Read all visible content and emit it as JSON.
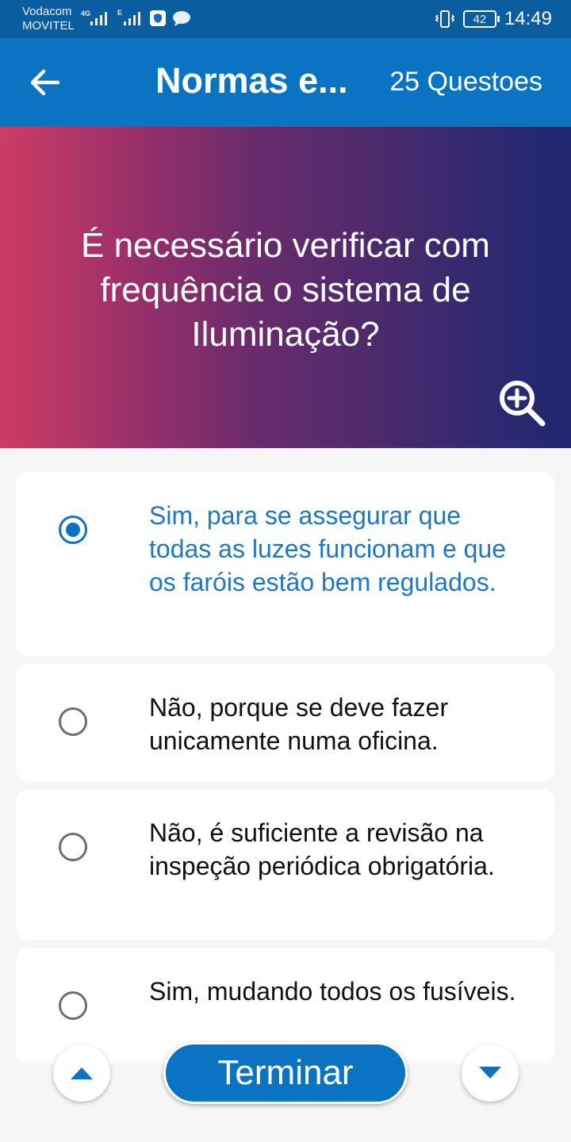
{
  "status_bar": {
    "carrier1": "Vodacom",
    "carrier2": "MOVITEL",
    "net1": "4G",
    "net2": "E",
    "battery": "42",
    "time": "14:49"
  },
  "app_bar": {
    "title": "Normas e...",
    "question_count": "25 Questoes",
    "color": "#0a74c2"
  },
  "question": {
    "text": "É necessário verificar com frequência o sistema de Iluminação?"
  },
  "answers": [
    {
      "text": "Sim, para se assegurar que todas as luzes funcionam e que os faróis estão bem regulados.",
      "selected": true
    },
    {
      "text": "Não, porque se deve fazer unicamente numa oficina.",
      "selected": false
    },
    {
      "text": "Não, é suficiente a revisão na inspeção periódica obrigatória.",
      "selected": false
    },
    {
      "text": "Sim, mudando todos os fusíveis.",
      "selected": false
    }
  ],
  "controls": {
    "finish_label": "Terminar",
    "prev_icon": "caret-up-icon",
    "next_icon": "caret-down-icon"
  }
}
